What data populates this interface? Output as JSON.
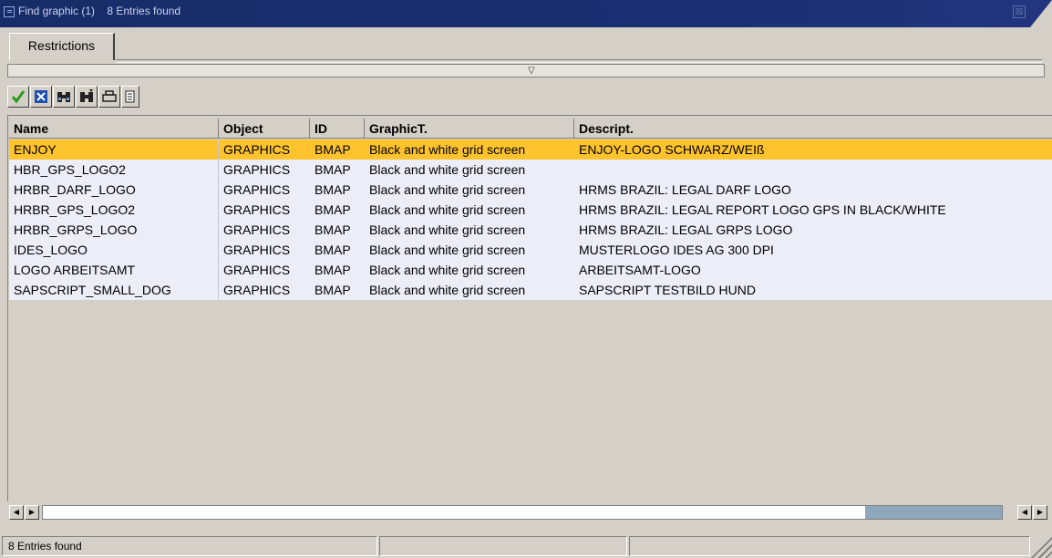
{
  "window": {
    "title": "Find graphic (1)    8 Entries found",
    "close_glyph": "⊠"
  },
  "tabs": [
    {
      "label": "Restrictions"
    }
  ],
  "collapse": {
    "glyph": "▽"
  },
  "toolbar": {
    "icons": [
      "check-icon",
      "cancel-icon",
      "find-icon",
      "find-next-icon",
      "print-icon",
      "sort-icon"
    ]
  },
  "table": {
    "columns": [
      "Name",
      "Object",
      "ID",
      "GraphicT.",
      "Descript."
    ],
    "rows": [
      {
        "name": "ENJOY",
        "object": "GRAPHICS",
        "id": "BMAP",
        "graphic_type": "Black and white grid screen",
        "description": "ENJOY-LOGO SCHWARZ/WEIß",
        "selected": true
      },
      {
        "name": "HBR_GPS_LOGO2",
        "object": "GRAPHICS",
        "id": "BMAP",
        "graphic_type": "Black and white grid screen",
        "description": "",
        "selected": false
      },
      {
        "name": "HRBR_DARF_LOGO",
        "object": "GRAPHICS",
        "id": "BMAP",
        "graphic_type": "Black and white grid screen",
        "description": "HRMS BRAZIL: LEGAL DARF LOGO",
        "selected": false
      },
      {
        "name": "HRBR_GPS_LOGO2",
        "object": "GRAPHICS",
        "id": "BMAP",
        "graphic_type": "Black and white grid screen",
        "description": "HRMS BRAZIL: LEGAL REPORT LOGO GPS IN BLACK/WHITE",
        "selected": false
      },
      {
        "name": "HRBR_GRPS_LOGO",
        "object": "GRAPHICS",
        "id": "BMAP",
        "graphic_type": "Black and white grid screen",
        "description": "HRMS BRAZIL: LEGAL GRPS LOGO",
        "selected": false
      },
      {
        "name": "IDES_LOGO",
        "object": "GRAPHICS",
        "id": "BMAP",
        "graphic_type": "Black and white grid screen",
        "description": "MUSTERLOGO IDES AG 300 DPI",
        "selected": false
      },
      {
        "name": "LOGO ARBEITSAMT",
        "object": "GRAPHICS",
        "id": "BMAP",
        "graphic_type": "Black and white grid screen",
        "description": "ARBEITSAMT-LOGO",
        "selected": false
      },
      {
        "name": "SAPSCRIPT_SMALL_DOG",
        "object": "GRAPHICS",
        "id": "BMAP",
        "graphic_type": "Black and white grid screen",
        "description": "SAPSCRIPT TESTBILD HUND",
        "selected": false
      }
    ]
  },
  "scroll": {
    "left_glyph": "◀",
    "right_glyph": "▶"
  },
  "status": {
    "text": "8 Entries found"
  },
  "colors": {
    "title_bar": "#1b3073",
    "selection": "#ffc32e",
    "row_bg": "#ecedf7",
    "chrome": "#d4d0c8"
  }
}
